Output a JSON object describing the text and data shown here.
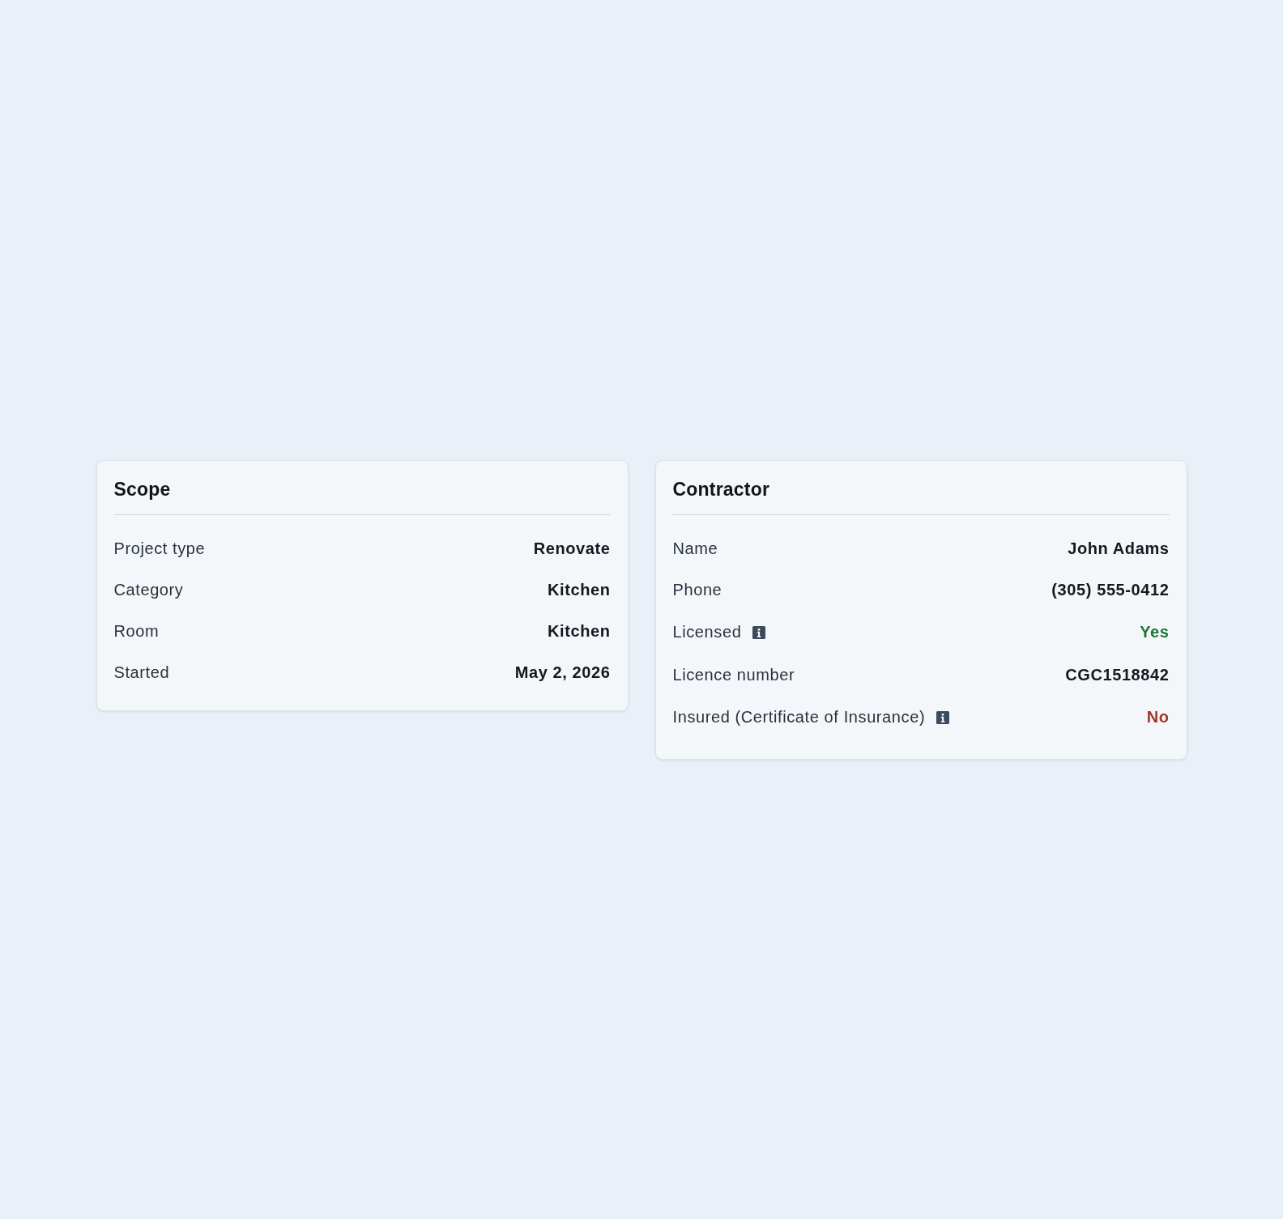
{
  "cards": [
    {
      "title": "Scope",
      "rows": [
        {
          "label": "Project type",
          "info": false,
          "value": "Renovate"
        },
        {
          "label": "Category",
          "info": false,
          "value": "Kitchen"
        },
        {
          "label": "Room",
          "info": false,
          "value": "Kitchen"
        },
        {
          "label": "Started",
          "info": false,
          "value": "May 2, 2026"
        }
      ]
    },
    {
      "title": "Contractor",
      "rows": [
        {
          "label": "Name",
          "info": false,
          "value": "John Adams"
        },
        {
          "label": "Phone",
          "info": false,
          "value": "(305) 555-0412"
        },
        {
          "label": "Licensed",
          "info": true,
          "value": "Yes",
          "color": "#1c7534"
        },
        {
          "label": "Licence number",
          "info": false,
          "value": "CGC1518842"
        },
        {
          "label": "Insured (Certificate of Insurance)",
          "info": true,
          "value": "No",
          "color": "#a0382a"
        }
      ]
    }
  ]
}
